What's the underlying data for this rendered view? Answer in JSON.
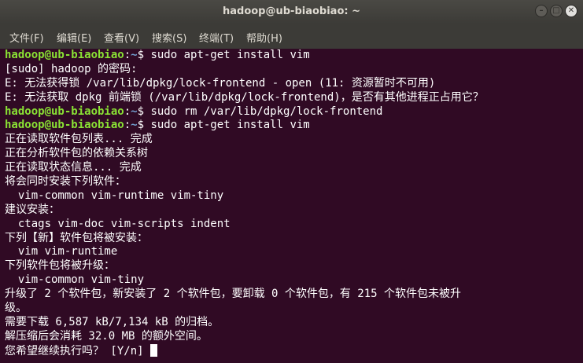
{
  "window": {
    "title": "hadoop@ub-biaobiao: ~"
  },
  "menu": {
    "items": [
      "文件(F)",
      "编辑(E)",
      "查看(V)",
      "搜索(S)",
      "终端(T)",
      "帮助(H)"
    ]
  },
  "terminal": {
    "prompt_user": "hadoop@ub-biaobiao",
    "prompt_path": "~",
    "lines": [
      {
        "type": "prompt",
        "cmd": "sudo apt-get install vim"
      },
      {
        "type": "text",
        "text": "[sudo] hadoop 的密码:"
      },
      {
        "type": "text",
        "text": "E: 无法获得锁 /var/lib/dpkg/lock-frontend - open (11: 资源暂时不可用)"
      },
      {
        "type": "text",
        "text": "E: 无法获取 dpkg 前端锁 (/var/lib/dpkg/lock-frontend)，是否有其他进程正占用它？"
      },
      {
        "type": "prompt",
        "cmd": "sudo rm /var/lib/dpkg/lock-frontend"
      },
      {
        "type": "prompt",
        "cmd": "sudo apt-get install vim"
      },
      {
        "type": "text",
        "text": "正在读取软件包列表... 完成"
      },
      {
        "type": "text",
        "text": "正在分析软件包的依赖关系树"
      },
      {
        "type": "text",
        "text": "正在读取状态信息... 完成"
      },
      {
        "type": "text",
        "text": "将会同时安装下列软件："
      },
      {
        "type": "text",
        "text": "  vim-common vim-runtime vim-tiny"
      },
      {
        "type": "text",
        "text": "建议安装："
      },
      {
        "type": "text",
        "text": "  ctags vim-doc vim-scripts indent"
      },
      {
        "type": "text",
        "text": "下列【新】软件包将被安装："
      },
      {
        "type": "text",
        "text": "  vim vim-runtime"
      },
      {
        "type": "text",
        "text": "下列软件包将被升级："
      },
      {
        "type": "text",
        "text": "  vim-common vim-tiny"
      },
      {
        "type": "text",
        "text": "升级了 2 个软件包，新安装了 2 个软件包，要卸载 0 个软件包，有 215 个软件包未被升"
      },
      {
        "type": "text",
        "text": "级。"
      },
      {
        "type": "text",
        "text": "需要下载 6,587 kB/7,134 kB 的归档。"
      },
      {
        "type": "text",
        "text": "解压缩后会消耗 32.0 MB 的额外空间。"
      },
      {
        "type": "input",
        "text": "您希望继续执行吗？ [Y/n] "
      }
    ]
  },
  "colors": {
    "background": "#300a24",
    "prompt_user": "#8ae234",
    "prompt_path": "#729fcf",
    "text": "#ffffff"
  }
}
